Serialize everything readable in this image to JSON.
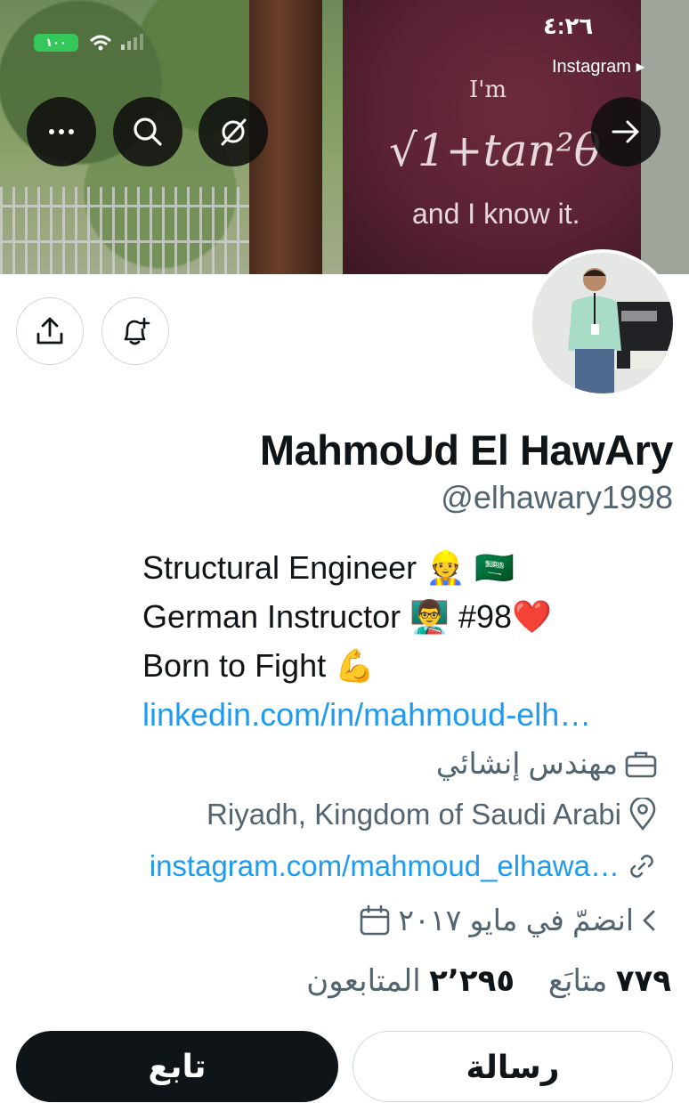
{
  "status_bar": {
    "time": "٤:٢٦",
    "back_app": "Instagram ▸",
    "battery": "١٠٠"
  },
  "banner": {
    "shirt_line1": "I'm",
    "shirt_formula": "√1+tan²θ",
    "shirt_line3": "and I know it."
  },
  "profile": {
    "name": "MahmoUd El HawAry",
    "handle": "@elhawary1998",
    "bio": [
      "Structural Engineer 👷 🇸🇦",
      "German Instructor 👨‍🏫 #98❤️",
      "Born to Fight 💪"
    ],
    "bio_link": "linkedin.com/in/mahmoud-elh…",
    "profession": "مهندس إنشائي",
    "location": "Riyadh, Kingdom of Saudi Arabi",
    "website": "instagram.com/mahmoud_elhawa…",
    "joined": "انضمّ في مايو ٢٠١٧"
  },
  "stats": {
    "following_count": "٧٧٩",
    "following_label": "متابَع",
    "followers_count": "٢٬٢٩٥",
    "followers_label": "المتابعون"
  },
  "actions": {
    "follow": "تابع",
    "message": "رسالة"
  },
  "icons": {
    "more": "more-icon",
    "search": "search-icon",
    "grok": "grok-icon",
    "forward": "arrow-right-icon",
    "share": "share-icon",
    "notify": "bell-plus-icon"
  }
}
